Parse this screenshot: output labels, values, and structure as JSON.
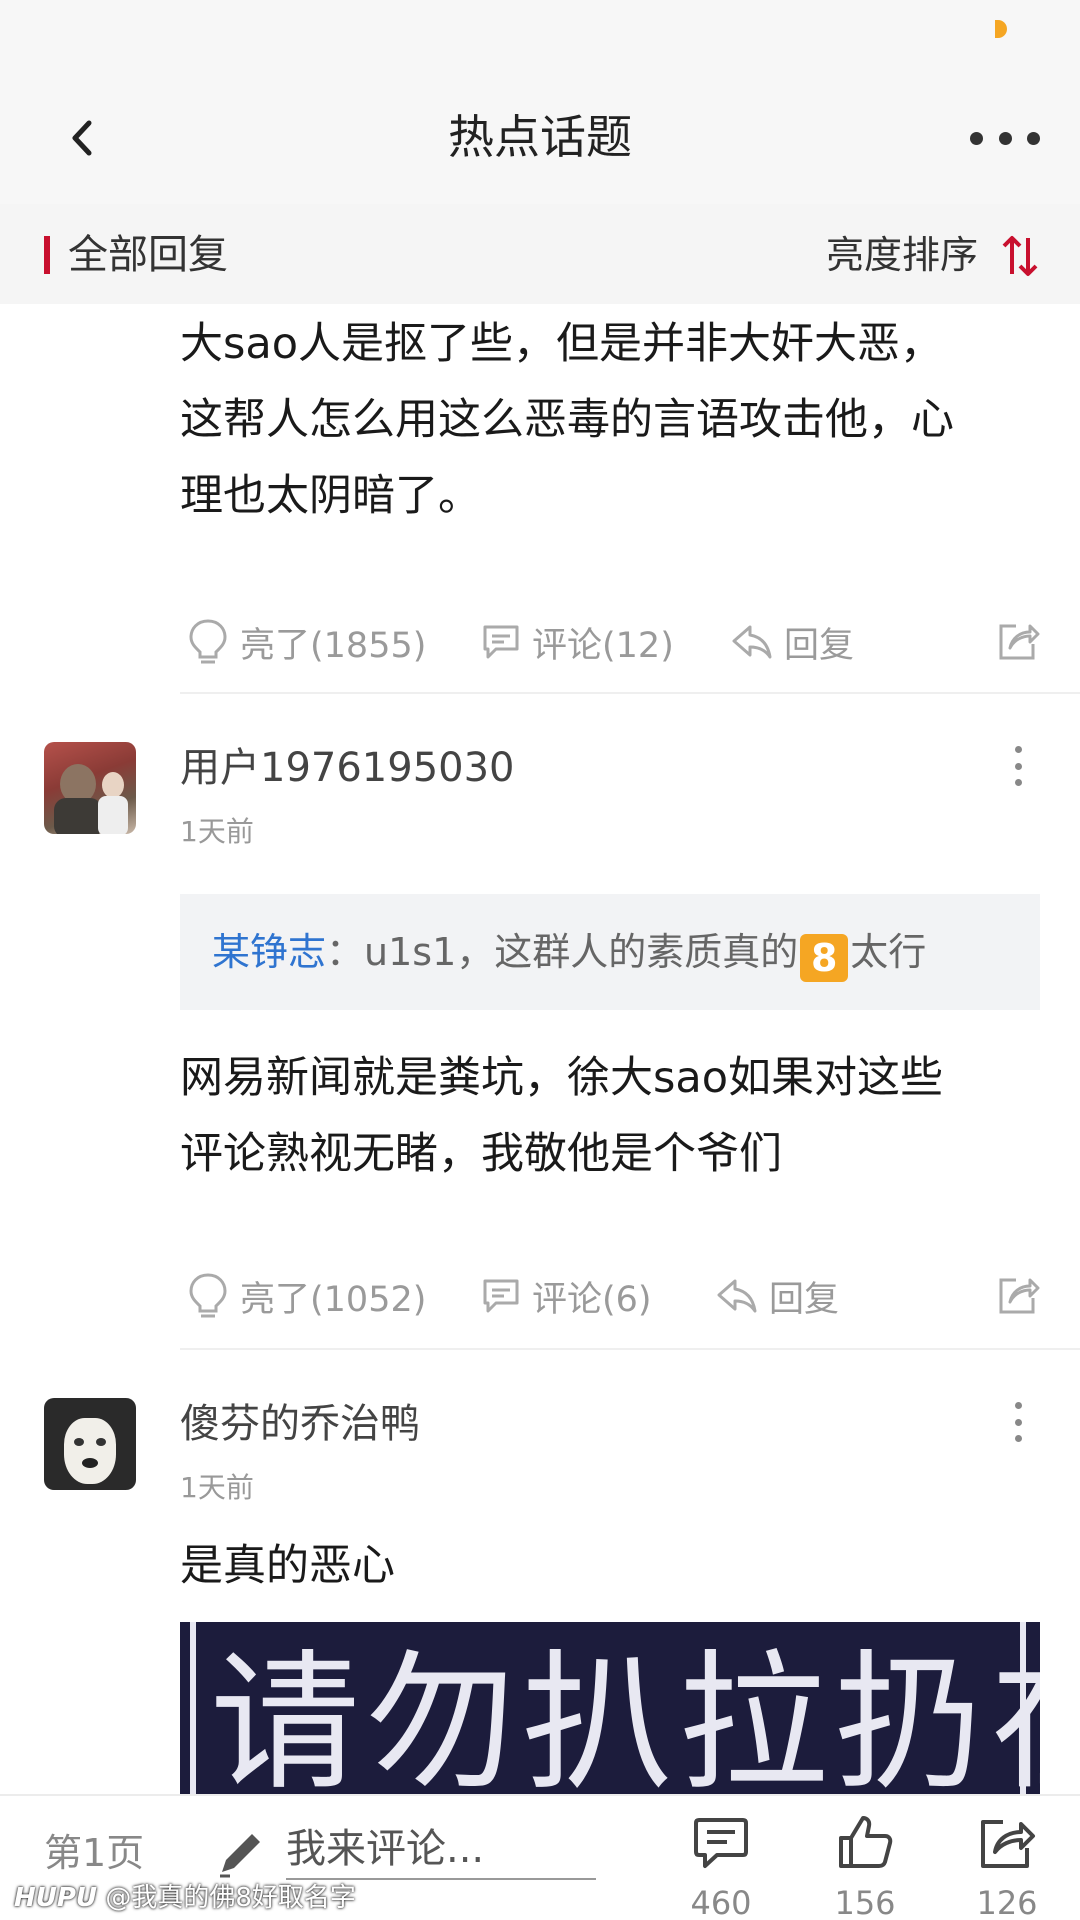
{
  "header": {
    "title": "热点话题",
    "back_icon": "chevron-left-icon",
    "more_icon": "more-horizontal-icon"
  },
  "filter": {
    "title": "全部回复",
    "sort_label": "亮度排序",
    "accent_color": "#c8102e"
  },
  "comments": [
    {
      "text_lines": [
        "大sao人是抠了些，但是并非大奸大恶，",
        "这帮人怎么用这么恶毒的言语攻击他，心",
        "理也太阴暗了。"
      ],
      "likes": "亮了(1855)",
      "comments": "评论(12)",
      "reply": "回复"
    },
    {
      "username": "用户1976195030",
      "time": "1天前",
      "quote_author": "某铮志",
      "quote_text_before": "：u1s1，这群人的素质真的",
      "quote_emoji": "8",
      "quote_text_after": "太行",
      "text_lines": [
        "网易新闻就是粪坑，徐大sao如果对这些",
        "评论熟视无睹，我敬他是个爷们"
      ],
      "likes": "亮了(1052)",
      "comments": "评论(6)",
      "reply": "回复"
    },
    {
      "username": "傻芬的乔治鸭",
      "time": "1天前",
      "text": "是真的恶心",
      "image_text": "请勿扒拉扔在此"
    }
  ],
  "bottom": {
    "page_label": "第1页",
    "input_placeholder": "我来评论...",
    "comment_count": "460",
    "like_count": "156",
    "share_count": "126"
  },
  "watermark": {
    "brand": "HUPU",
    "text": "@我真的佛8好取名字"
  }
}
